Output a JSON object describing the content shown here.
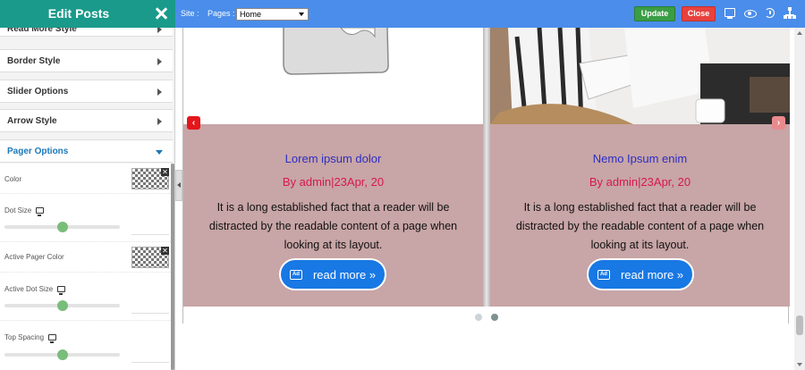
{
  "sidebar": {
    "title": "Edit Posts",
    "sections": [
      {
        "label": "Read More Style"
      },
      {
        "label": "Border Style"
      },
      {
        "label": "Slider Options"
      },
      {
        "label": "Arrow Style"
      },
      {
        "label": "Pager Options"
      }
    ],
    "pager_options": {
      "color_label": "Color",
      "dot_size_label": "Dot Size",
      "dot_size_value": 0.5,
      "active_color_label": "Active Pager Color",
      "active_dot_size_label": "Active Dot Size",
      "active_dot_size_value": 0.5,
      "top_spacing_label": "Top Spacing",
      "top_spacing_value": 0.5
    }
  },
  "topbar": {
    "site_label": "Site :",
    "pages_label": "Pages :",
    "pages_selected": "Home",
    "update_label": "Update",
    "close_label": "Close",
    "icons": [
      "desktop-icon",
      "eye-icon",
      "history-icon",
      "sitemap-icon"
    ],
    "colors": {
      "bar": "#4a8dea",
      "update": "#3a9d45",
      "close": "#e8413e"
    }
  },
  "posts": [
    {
      "title": "Lorem ipsum dolor",
      "meta": "By admin|23Apr, 20",
      "excerpt": "It is a long established fact that a reader will be distracted by the readable content of a page when looking at its layout.",
      "button": "read more »"
    },
    {
      "title": "Nemo Ipsum enim",
      "meta": "By admin|23Apr, 20",
      "excerpt": "It is a long established fact that a reader will be distracted by the readable content of a page when looking at its layout.",
      "button": "read more »"
    }
  ],
  "slider": {
    "prev_glyph": "‹",
    "next_glyph": "›",
    "pager_dots": 2,
    "active_dot": 2
  }
}
